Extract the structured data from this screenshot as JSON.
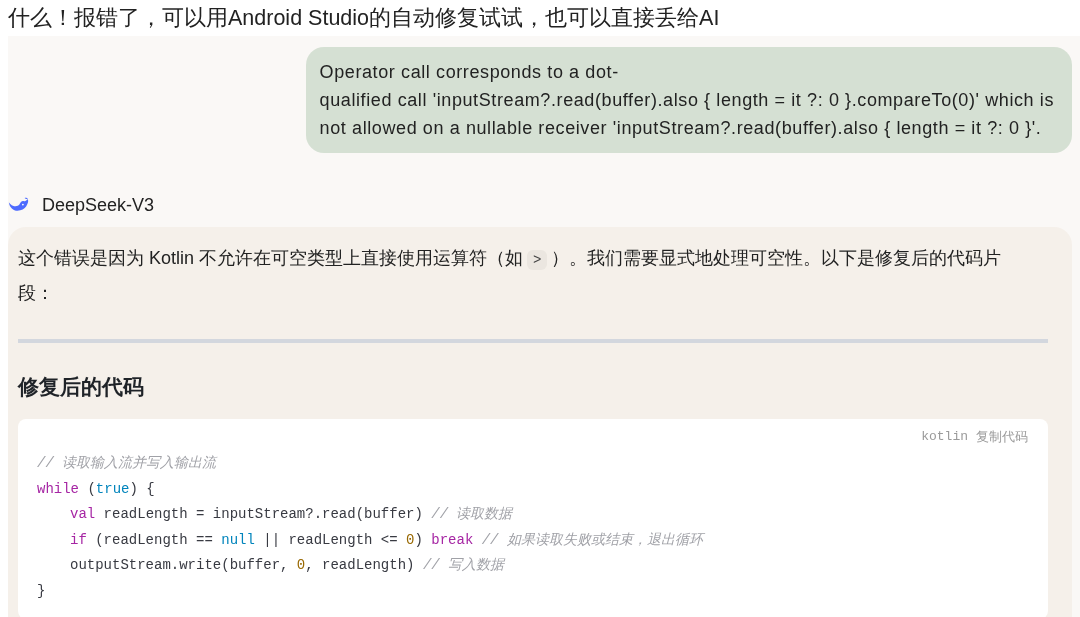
{
  "prompt": {
    "text": "什么！报错了，可以用Android Studio的自动修复试试，也可以直接丢给AI"
  },
  "user_message": {
    "lines": [
      "Operator call corresponds to a dot-",
      "qualified call 'inputStream?.read(buffer).also { length = it ?: 0 }.compareTo(0)' which is",
      "not allowed on a nullable receiver 'inputStream?.read(buffer).also { length = it ?: 0 }'."
    ]
  },
  "assistant": {
    "model_name": "DeepSeek-V3",
    "paragraph": [
      {
        "kind": "text",
        "text": "这个错误是因为 Kotlin 不允许在可空类型上直接使用运算符（如"
      },
      {
        "kind": "code",
        "text": ">"
      },
      {
        "kind": "text",
        "text": "）。我们需要显式地处理可空性。以下是修复后的代码片段："
      }
    ],
    "heading": "修复后的代码",
    "code_block": {
      "language": "kotlin",
      "copy_label": "复制代码",
      "lines": [
        {
          "tokens": [
            {
              "kind": "comment",
              "text": "// 读取输入流并写入输出流"
            }
          ]
        },
        {
          "tokens": [
            {
              "kind": "keyword",
              "text": "while"
            },
            {
              "kind": "plain",
              "text": " ("
            },
            {
              "kind": "literal",
              "text": "true"
            },
            {
              "kind": "plain",
              "text": ") {"
            }
          ],
          "children": [
            {
              "tokens": [
                {
                  "kind": "keyword",
                  "text": "val"
                },
                {
                  "kind": "plain",
                  "text": " readLength = inputStream?.read(buffer) "
                },
                {
                  "kind": "comment",
                  "text": "// 读取数据"
                }
              ]
            },
            {
              "tokens": [
                {
                  "kind": "keyword",
                  "text": "if"
                },
                {
                  "kind": "plain",
                  "text": " (readLength == "
                },
                {
                  "kind": "literal",
                  "text": "null"
                },
                {
                  "kind": "plain",
                  "text": " || readLength <= "
                },
                {
                  "kind": "number",
                  "text": "0"
                },
                {
                  "kind": "plain",
                  "text": ") "
                },
                {
                  "kind": "keyword",
                  "text": "break"
                },
                {
                  "kind": "comment",
                  "text": " // 如果读取失败或结束，退出循环"
                }
              ]
            },
            {
              "tokens": [
                {
                  "kind": "plain",
                  "text": "outputStream.write(buffer, "
                },
                {
                  "kind": "number",
                  "text": "0"
                },
                {
                  "kind": "plain",
                  "text": ", readLength) "
                },
                {
                  "kind": "comment",
                  "text": "// 写入数据"
                }
              ]
            }
          ]
        },
        {
          "tokens": [
            {
              "kind": "plain",
              "text": "}"
            }
          ]
        }
      ]
    }
  }
}
